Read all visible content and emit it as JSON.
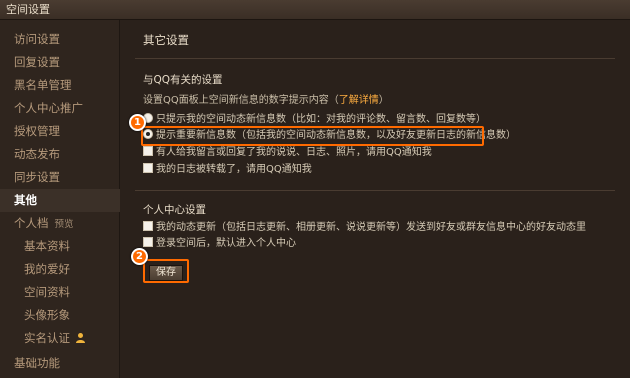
{
  "window": {
    "title": "空间设置"
  },
  "sidebar": {
    "items": [
      {
        "label": "访问设置"
      },
      {
        "label": "回复设置"
      },
      {
        "label": "黑名单管理"
      },
      {
        "label": "个人中心推广"
      },
      {
        "label": "授权管理"
      },
      {
        "label": "动态发布"
      },
      {
        "label": "同步设置"
      },
      {
        "label": "其他"
      },
      {
        "label": "个人档",
        "tag": "预览"
      },
      {
        "label": "基本资料"
      },
      {
        "label": "我的爱好"
      },
      {
        "label": "空间资料"
      },
      {
        "label": "头像形象"
      },
      {
        "label": "实名认证"
      },
      {
        "label": "基础功能"
      }
    ],
    "active_index": 7
  },
  "main": {
    "title": "其它设置",
    "qq_section": {
      "title": "与QQ有关的设置",
      "desc_prefix": "设置QQ面板上空间新信息的数字提示内容（",
      "link": "了解详情",
      "desc_suffix": "）",
      "options": [
        {
          "type": "radio",
          "checked": false,
          "label": "只提示我的空间动态新信息数（比如：对我的评论数、留言数、回复数等）"
        },
        {
          "type": "radio",
          "checked": true,
          "label": "提示重要新信息数（包括我的空间动态新信息数，以及好友更新日志的新信息数）"
        },
        {
          "type": "checkbox",
          "checked": false,
          "label": "有人给我留言或回复了我的说说、日志、照片，请用QQ通知我"
        },
        {
          "type": "checkbox",
          "checked": false,
          "label": "我的日志被转载了，请用QQ通知我"
        }
      ]
    },
    "personal_section": {
      "title": "个人中心设置",
      "options": [
        {
          "type": "checkbox",
          "checked": false,
          "label": "我的动态更新（包括日志更新、相册更新、说说更新等）发送到好友或群友信息中心的好友动态里"
        },
        {
          "type": "checkbox",
          "checked": false,
          "label": "登录空间后，默认进入个人中心"
        }
      ]
    },
    "save_label": "保存",
    "callouts": [
      "1",
      "2"
    ]
  },
  "colors": {
    "background": "#2a211b",
    "sidebar": "#2f251e",
    "highlight": "#ff6a00",
    "link": "#ffae40"
  }
}
